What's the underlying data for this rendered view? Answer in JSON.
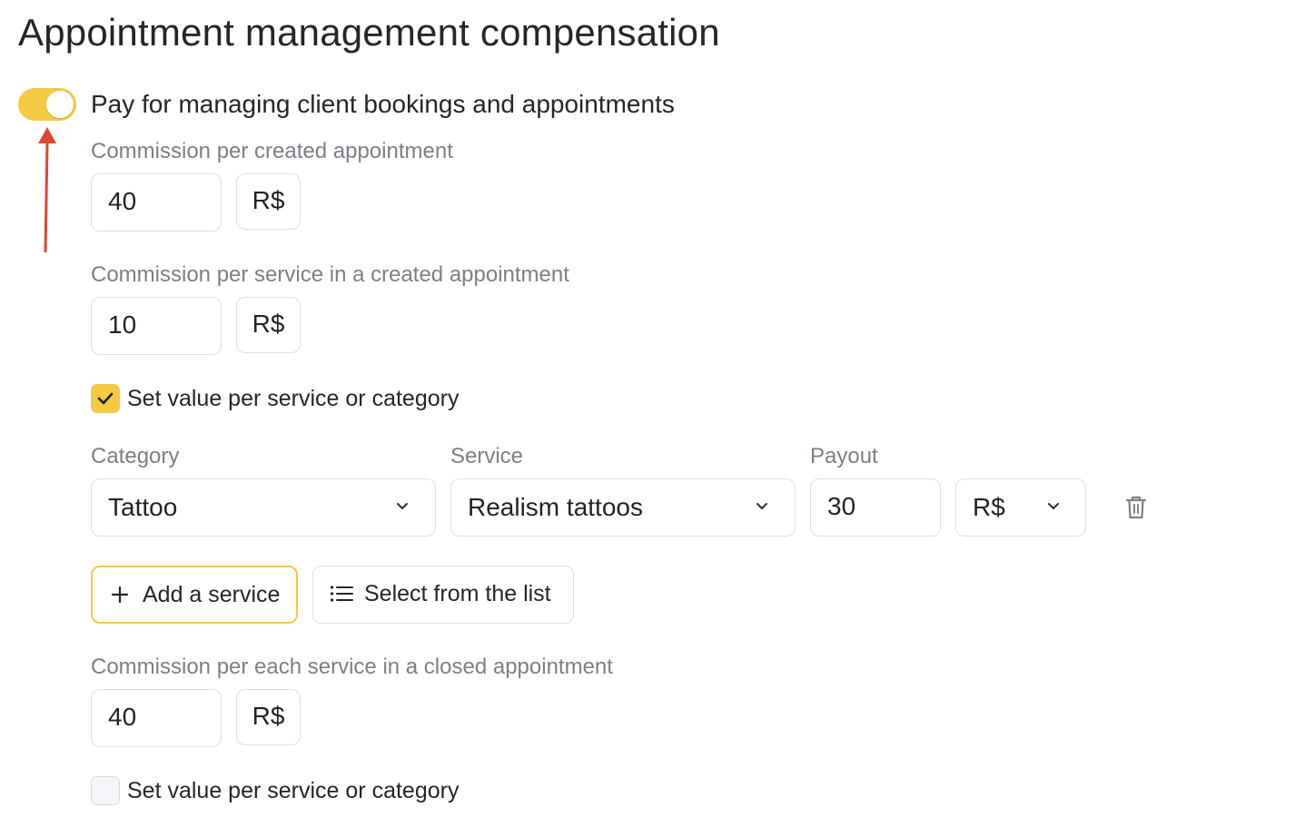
{
  "page": {
    "title": "Appointment management compensation"
  },
  "toggle": {
    "label": "Pay for managing client bookings and appointments",
    "on": true
  },
  "created_appointment": {
    "label": "Commission per created appointment",
    "value": "40",
    "currency": "R$"
  },
  "service_in_created": {
    "label": "Commission per service in a created appointment",
    "value": "10",
    "currency": "R$",
    "per_service_checkbox": {
      "label": "Set value per service or category",
      "checked": true
    }
  },
  "table": {
    "headers": {
      "category": "Category",
      "service": "Service",
      "payout": "Payout"
    },
    "rows": [
      {
        "category": "Tattoo",
        "service": "Realism tattoos",
        "payout": "30",
        "currency": "R$"
      }
    ]
  },
  "buttons": {
    "add_service": "Add a service",
    "select_list": "Select from the list"
  },
  "closed_appointment": {
    "label": "Commission per each service in a closed appointment",
    "value": "40",
    "currency": "R$",
    "per_service_checkbox": {
      "label": "Set value per service or category",
      "checked": false
    }
  },
  "colors": {
    "accent": "#f6c943",
    "annotation_arrow": "#e2452f",
    "muted_text": "#7b7f87",
    "border": "#dcdfe4"
  },
  "icons": [
    "chevron-down-icon",
    "trash-icon",
    "plus-icon",
    "list-icon",
    "check-icon",
    "arrow-up-icon"
  ]
}
